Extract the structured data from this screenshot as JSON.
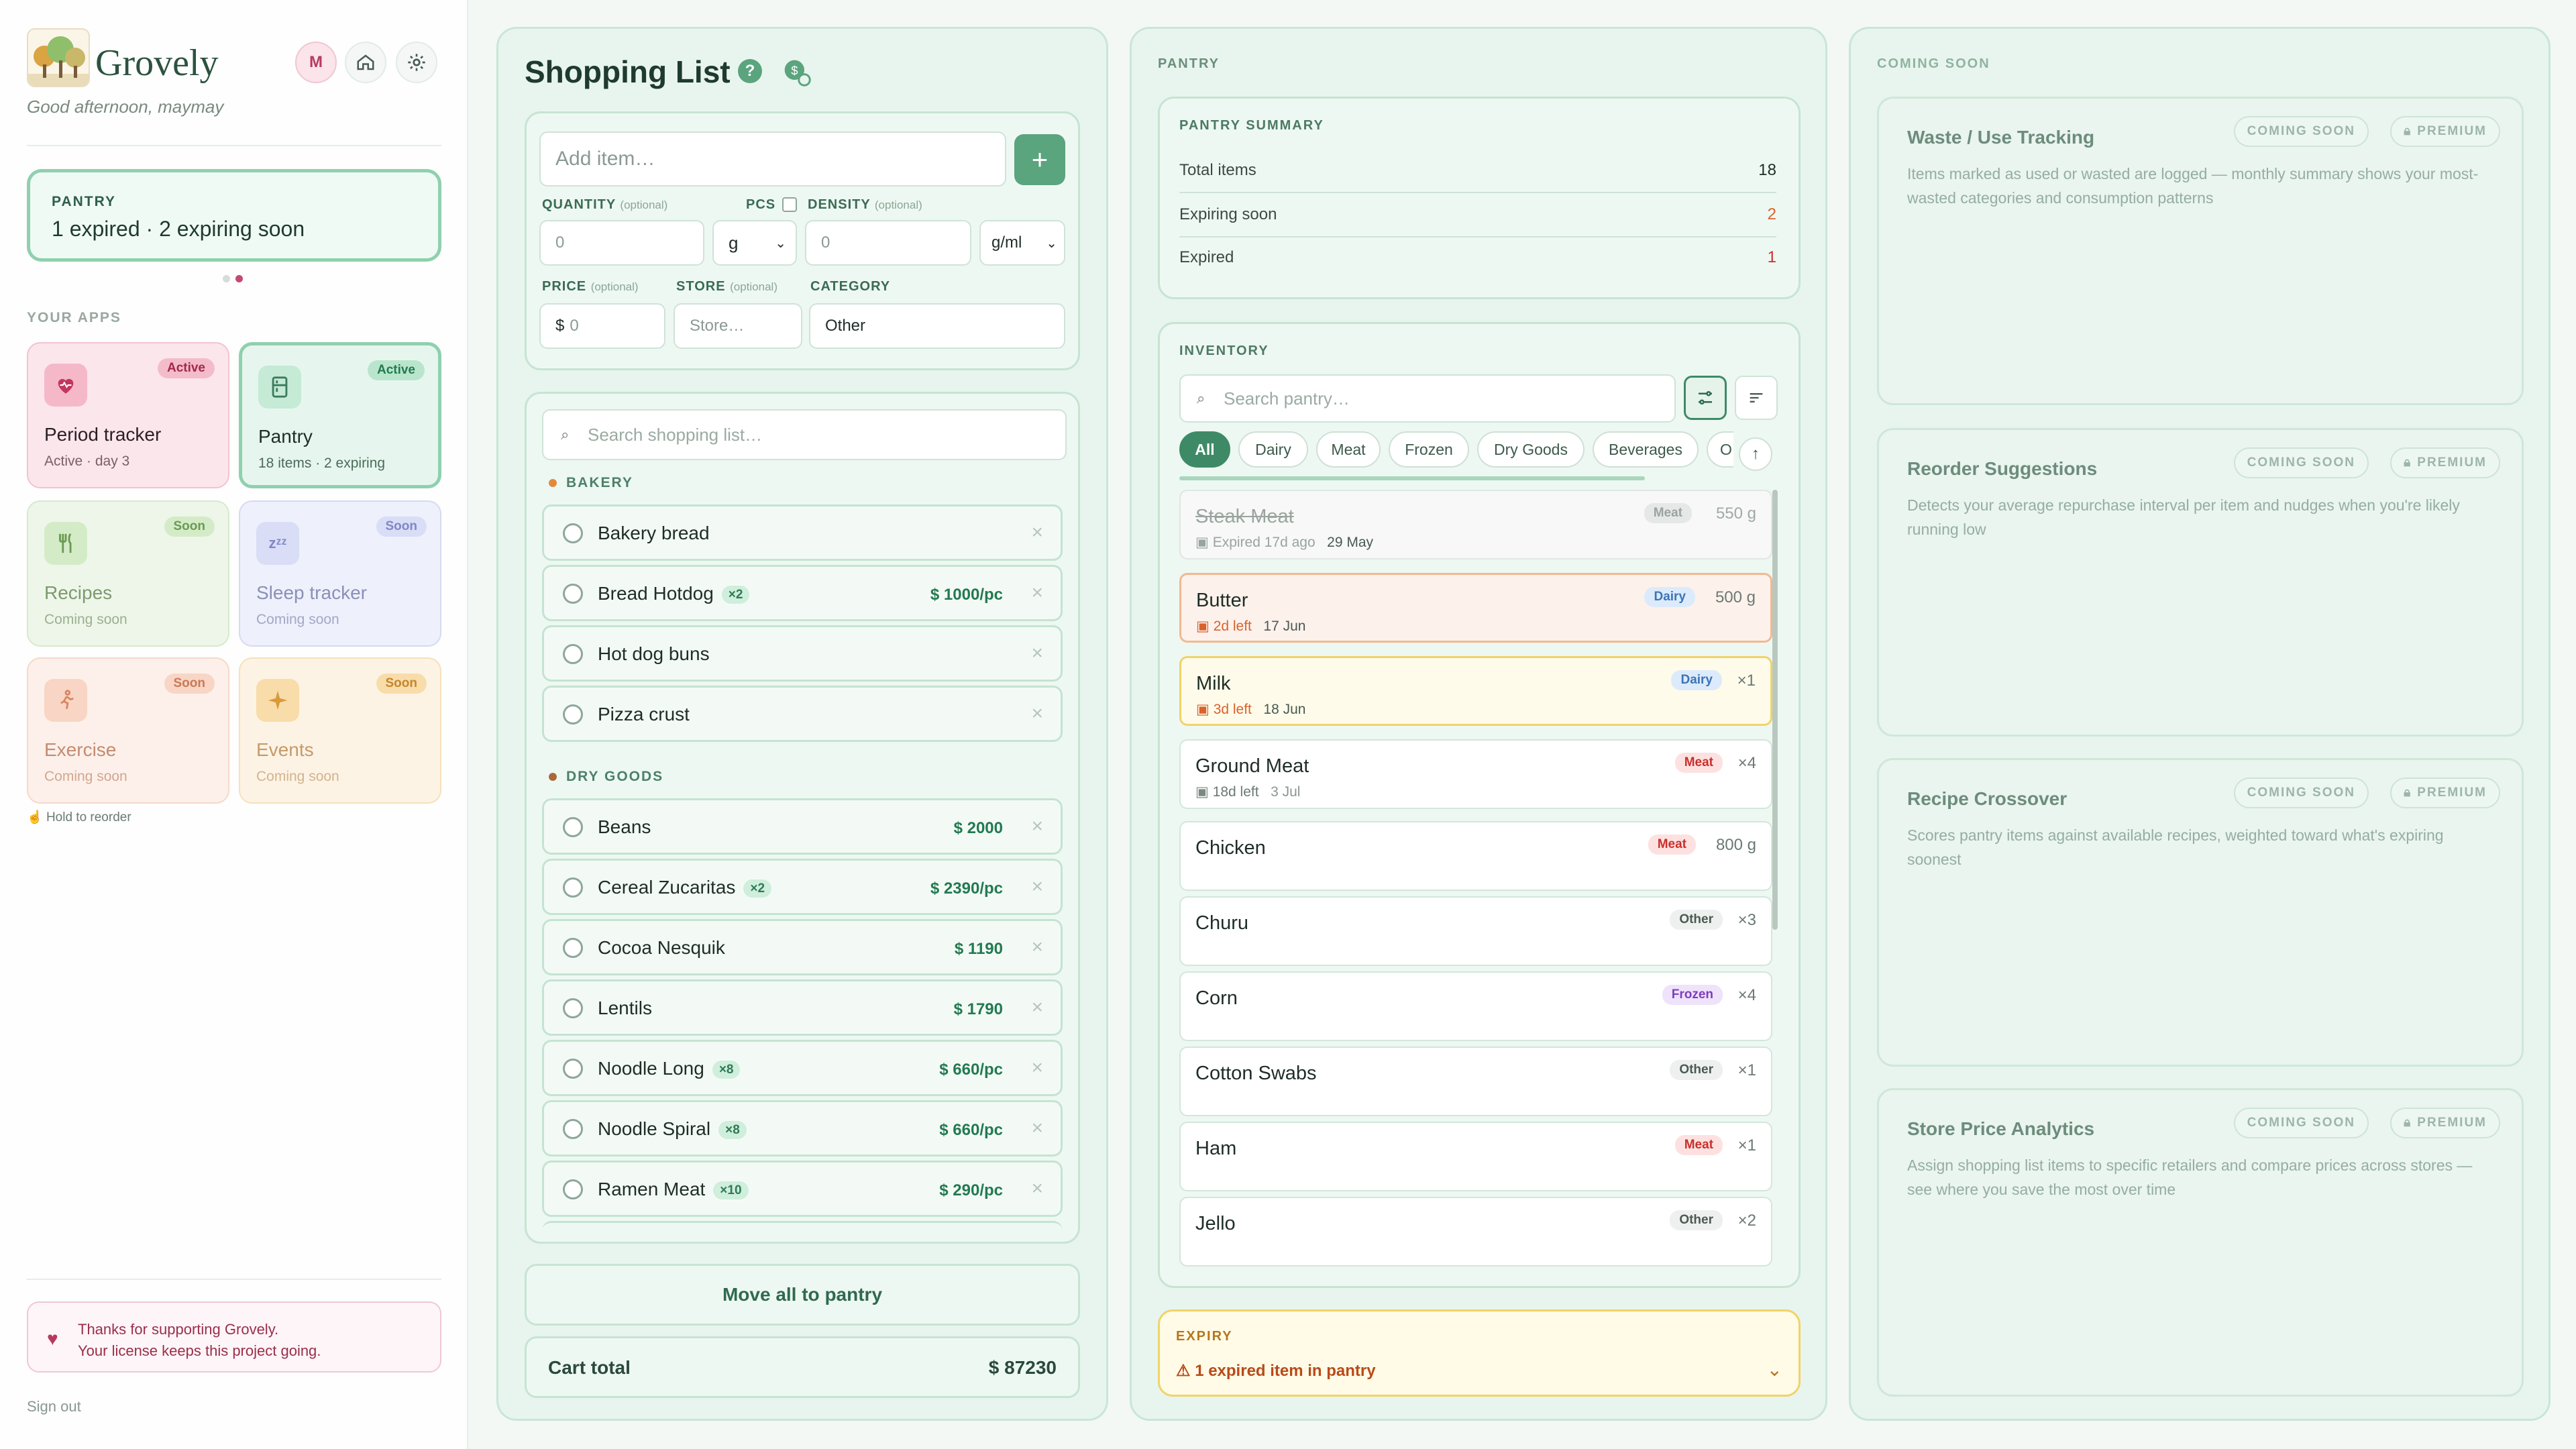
{
  "sidebar": {
    "brand": "Grovely",
    "greeting": "Good afternoon, maymay",
    "avatar_initial": "M",
    "pantry_card": {
      "label": "PANTRY",
      "text": "1 expired · 2 expiring soon"
    },
    "apps_label": "YOUR APPS",
    "apps": [
      {
        "name": "Period tracker",
        "sub": "Active · day 3",
        "badge": "Active",
        "icon": "heart-pulse-icon"
      },
      {
        "name": "Pantry",
        "sub": "18 items · 2 expiring",
        "badge": "Active",
        "icon": "fridge-icon"
      },
      {
        "name": "Recipes",
        "sub": "Coming soon",
        "badge": "Soon",
        "icon": "fork-knife-icon"
      },
      {
        "name": "Sleep tracker",
        "sub": "Coming soon",
        "badge": "Soon",
        "icon": "zzz-icon"
      },
      {
        "name": "Exercise",
        "sub": "Coming soon",
        "badge": "Soon",
        "icon": "running-icon"
      },
      {
        "name": "Events",
        "sub": "Coming soon",
        "badge": "Soon",
        "icon": "sparkle-icon"
      }
    ],
    "hold_hint": "Hold to reorder",
    "thanks_line1": "Thanks for supporting Grovely.",
    "thanks_line2": "Your license keeps this project going.",
    "sign_out": "Sign out"
  },
  "shopping": {
    "title": "Shopping List",
    "add_placeholder": "Add item…",
    "quantity_label": "QUANTITY",
    "optional": "(optional)",
    "pcs_label": "PCS",
    "density_label": "DENSITY",
    "quantity_value": "0",
    "unit_value": "g",
    "density_value": "0",
    "density_unit": "g/ml",
    "price_label": "PRICE",
    "store_label": "STORE",
    "category_label": "CATEGORY",
    "price_prefix": "$",
    "price_value": "0",
    "store_placeholder": "Store…",
    "category_value": "Other",
    "search_placeholder": "Search shopping list…",
    "categories": [
      {
        "name": "BAKERY",
        "color": "#e08a3c"
      },
      {
        "name": "DRY GOODS",
        "color": "#a86a3c"
      }
    ],
    "items": [
      {
        "name": "Bakery bread",
        "qty": "",
        "price": ""
      },
      {
        "name": "Bread Hotdog",
        "qty": "×2",
        "price": "$ 1000/pc"
      },
      {
        "name": "Hot dog buns",
        "qty": "",
        "price": ""
      },
      {
        "name": "Pizza crust",
        "qty": "",
        "price": ""
      },
      {
        "name": "Beans",
        "qty": "",
        "price": "$ 2000"
      },
      {
        "name": "Cereal Zucaritas",
        "qty": "×2",
        "price": "$ 2390/pc"
      },
      {
        "name": "Cocoa Nesquik",
        "qty": "",
        "price": "$ 1190"
      },
      {
        "name": "Lentils",
        "qty": "",
        "price": "$ 1790"
      },
      {
        "name": "Noodle Long",
        "qty": "×8",
        "price": "$ 660/pc"
      },
      {
        "name": "Noodle Spiral",
        "qty": "×8",
        "price": "$ 660/pc"
      },
      {
        "name": "Ramen Meat",
        "qty": "×10",
        "price": "$ 290/pc"
      }
    ],
    "move_all": "Move all to pantry",
    "cart_total_label": "Cart total",
    "cart_total_value": "$ 87230"
  },
  "pantry": {
    "col_title": "PANTRY",
    "summary_title": "PANTRY SUMMARY",
    "summary": [
      {
        "label": "Total items",
        "value": "18",
        "color": "#1f2d27"
      },
      {
        "label": "Expiring soon",
        "value": "2",
        "color": "#d9622b"
      },
      {
        "label": "Expired",
        "value": "1",
        "color": "#c9302c"
      }
    ],
    "inventory_title": "INVENTORY",
    "search_placeholder": "Search pantry…",
    "chips": [
      "All",
      "Dairy",
      "Meat",
      "Frozen",
      "Dry Goods",
      "Beverages",
      "O"
    ],
    "items": [
      {
        "name": "Steak Meat",
        "tag": "Meat",
        "amount": "550 g",
        "status": "Expired 17d ago",
        "date": "29 May"
      },
      {
        "name": "Butter",
        "tag": "Dairy",
        "amount": "500 g",
        "status": "2d left",
        "date": "17 Jun"
      },
      {
        "name": "Milk",
        "tag": "Dairy",
        "amount": "×1",
        "status": "3d left",
        "date": "18 Jun"
      },
      {
        "name": "Ground Meat",
        "tag": "Meat",
        "amount": "×4",
        "status": "18d left",
        "date": "3 Jul"
      },
      {
        "name": "Chicken",
        "tag": "Meat",
        "amount": "800 g",
        "status": "",
        "date": ""
      },
      {
        "name": "Churu",
        "tag": "Other",
        "amount": "×3",
        "status": "",
        "date": ""
      },
      {
        "name": "Corn",
        "tag": "Frozen",
        "amount": "×4",
        "status": "",
        "date": ""
      },
      {
        "name": "Cotton Swabs",
        "tag": "Other",
        "amount": "×1",
        "status": "",
        "date": ""
      },
      {
        "name": "Ham",
        "tag": "Meat",
        "amount": "×1",
        "status": "",
        "date": ""
      },
      {
        "name": "Jello",
        "tag": "Other",
        "amount": "×2",
        "status": "",
        "date": ""
      }
    ],
    "expiry_title": "EXPIRY",
    "expiry_text": "1 expired item in pantry"
  },
  "coming_soon": {
    "col_title": "COMING SOON",
    "pill_soon": "COMING SOON",
    "pill_premium": "PREMIUM",
    "cards": [
      {
        "title": "Waste / Use Tracking",
        "desc": "Items marked as used or wasted are logged — monthly summary shows your most-wasted categories and consumption patterns"
      },
      {
        "title": "Reorder Suggestions",
        "desc": "Detects your average repurchase interval per item and nudges when you're likely running low"
      },
      {
        "title": "Recipe Crossover",
        "desc": "Scores pantry items against available recipes, weighted toward what's expiring soonest"
      },
      {
        "title": "Store Price Analytics",
        "desc": "Assign shopping list items to specific retailers and compare prices across stores — see where you save the most over time"
      }
    ]
  },
  "colors": {
    "accent": "#5aa47e",
    "expired": "#c9302c",
    "expiring": "#d9622b"
  }
}
